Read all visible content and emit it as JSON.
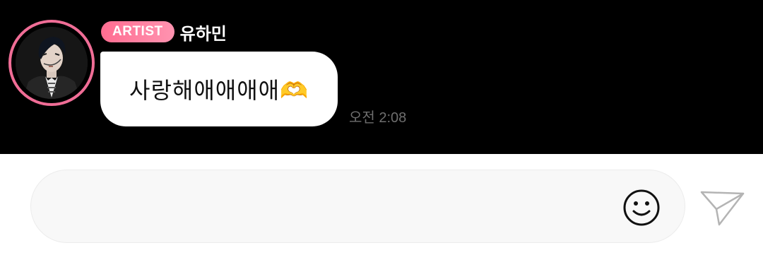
{
  "sender": {
    "badge_label": "ARTIST",
    "name": "유하민"
  },
  "message": {
    "text": "사랑해애애애애🫶",
    "time": "오전 2:08"
  },
  "composer": {
    "value": "",
    "placeholder": ""
  },
  "icons": {
    "emoji": "smiley-icon",
    "send": "paper-plane-icon"
  },
  "colors": {
    "badge": "#ff7a9c",
    "avatar_ring": "#f06d96",
    "chat_background": "#000000"
  }
}
